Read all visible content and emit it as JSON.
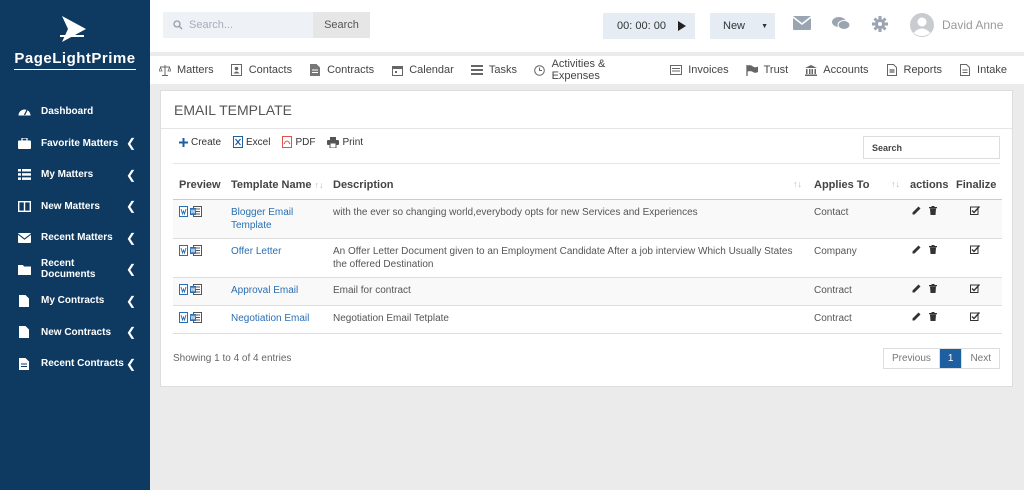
{
  "brand": {
    "name": "PageLightPrime"
  },
  "sidebar": {
    "items": [
      {
        "label": "Dashboard",
        "icon": "dashboard-icon",
        "has_chevron": false
      },
      {
        "label": "Favorite Matters",
        "icon": "briefcase-icon",
        "has_chevron": true
      },
      {
        "label": "My Matters",
        "icon": "list-icon",
        "has_chevron": true
      },
      {
        "label": "New Matters",
        "icon": "columns-icon",
        "has_chevron": true
      },
      {
        "label": "Recent Matters",
        "icon": "envelope-icon",
        "has_chevron": true
      },
      {
        "label": "Recent Documents",
        "icon": "folder-icon",
        "has_chevron": true
      },
      {
        "label": "My Contracts",
        "icon": "file-icon",
        "has_chevron": true
      },
      {
        "label": "New Contracts",
        "icon": "file-icon",
        "has_chevron": true
      },
      {
        "label": "Recent Contracts",
        "icon": "file-text-icon",
        "has_chevron": true
      }
    ]
  },
  "header": {
    "search_placeholder": "Search...",
    "search_button": "Search",
    "timer": "00: 00: 00",
    "new_button": "New",
    "user_name": "David Anne"
  },
  "menubar": {
    "items": [
      {
        "label": "Matters",
        "icon": "scale-icon"
      },
      {
        "label": "Contacts",
        "icon": "contact-card-icon"
      },
      {
        "label": "Contracts",
        "icon": "document-icon"
      },
      {
        "label": "Calendar",
        "icon": "calendar-icon"
      },
      {
        "label": "Tasks",
        "icon": "tasks-icon"
      },
      {
        "label": "Activities & Expenses",
        "icon": "clock-icon"
      },
      {
        "label": "Invoices",
        "icon": "invoice-icon"
      },
      {
        "label": "Trust",
        "icon": "flag-icon"
      },
      {
        "label": "Accounts",
        "icon": "bank-icon"
      },
      {
        "label": "Reports",
        "icon": "report-icon"
      },
      {
        "label": "Intake",
        "icon": "intake-icon"
      }
    ]
  },
  "panel": {
    "title": "EMAIL TEMPLATE",
    "toolbar": {
      "create": "Create",
      "excel": "Excel",
      "pdf": "PDF",
      "print": "Print"
    },
    "search_label": "Search",
    "columns": [
      "Preview",
      "Template Name",
      "Description",
      "Applies To",
      "actions",
      "Finalize"
    ],
    "rows": [
      {
        "name": "Blogger Email Template",
        "description": "with the ever so changing world,everybody opts for new Services and Experiences",
        "applies_to": "Contact"
      },
      {
        "name": "Offer Letter",
        "description": "An Offer Letter Document given to an Employment Candidate After a job interview Which Usually States the offered Destination",
        "applies_to": "Company"
      },
      {
        "name": "Approval Email",
        "description": "Email for contract",
        "applies_to": "Contract"
      },
      {
        "name": "Negotiation Email",
        "description": "Negotiation Email Tetplate",
        "applies_to": "Contract"
      }
    ],
    "footer": "Showing 1 to 4 of 4 entries",
    "pagination": {
      "previous": "Previous",
      "current": "1",
      "next": "Next"
    }
  },
  "colors": {
    "sidebar": "#0e3a62",
    "accent": "#1d5fa0",
    "link": "#2a6fb3"
  }
}
